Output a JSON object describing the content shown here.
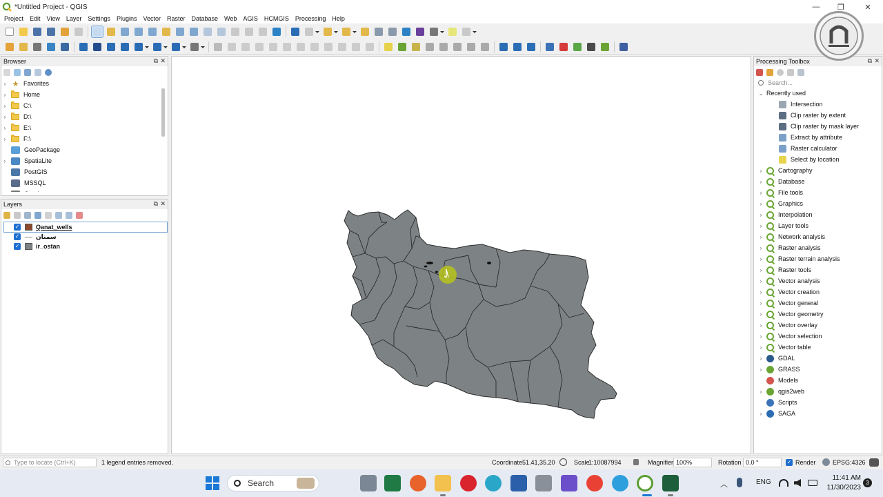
{
  "window": {
    "title": "*Untitled Project - QGIS",
    "minimize": "—",
    "restore": "❐",
    "close": "✕"
  },
  "menu": [
    "Project",
    "Edit",
    "View",
    "Layer",
    "Settings",
    "Plugins",
    "Vector",
    "Raster",
    "Database",
    "Web",
    "AGIS",
    "HCMGIS",
    "Processing",
    "Help"
  ],
  "browser": {
    "title": "Browser",
    "items": [
      {
        "label": "Favorites",
        "icon": "star-icon",
        "expandable": true
      },
      {
        "label": "Home",
        "icon": "folder-icon",
        "expandable": true
      },
      {
        "label": "C:\\",
        "icon": "folder-icon",
        "expandable": true
      },
      {
        "label": "D:\\",
        "icon": "folder-icon",
        "expandable": true
      },
      {
        "label": "E:\\",
        "icon": "folder-icon",
        "expandable": true
      },
      {
        "label": "F:\\",
        "icon": "folder-icon",
        "expandable": true
      },
      {
        "label": "GeoPackage",
        "icon": "geopackage-icon",
        "expandable": false
      },
      {
        "label": "SpatiaLite",
        "icon": "spatialite-icon",
        "expandable": true
      },
      {
        "label": "PostGIS",
        "icon": "postgis-icon",
        "expandable": false
      },
      {
        "label": "MSSQL",
        "icon": "mssql-icon",
        "expandable": false
      },
      {
        "label": "Oracle",
        "icon": "oracle-icon",
        "expandable": false
      }
    ]
  },
  "layers": {
    "title": "Layers",
    "items": [
      {
        "name": "Qanat_wells",
        "checked": true,
        "swatch": "#8b4a2b",
        "selected": true
      },
      {
        "name": "سمنان",
        "checked": true,
        "swatch": "line",
        "selected": false
      },
      {
        "name": "ir_ostan",
        "checked": true,
        "swatch": "#7d8384",
        "selected": false
      }
    ]
  },
  "toolbox": {
    "title": "Processing Toolbox",
    "search_placeholder": "Search...",
    "recent_label": "Recently used",
    "recent": [
      "Intersection",
      "Clip raster by extent",
      "Clip raster by mask layer",
      "Extract by attribute",
      "Raster calculator",
      "Select by location"
    ],
    "groups": [
      "Cartography",
      "Database",
      "File tools",
      "Graphics",
      "Interpolation",
      "Layer tools",
      "Network analysis",
      "Raster analysis",
      "Raster terrain analysis",
      "Raster tools",
      "Vector analysis",
      "Vector creation",
      "Vector general",
      "Vector geometry",
      "Vector overlay",
      "Vector selection",
      "Vector table"
    ],
    "providers": [
      "GDAL",
      "GRASS",
      "Models",
      "qgis2web",
      "Scripts",
      "SAGA"
    ]
  },
  "statusbar": {
    "locate_placeholder": "Type to locate (Ctrl+K)",
    "message": "1 legend entries removed.",
    "coordinate_label": "Coordinate",
    "coordinate_value": "51.41,35.20",
    "scale_label": "Scale",
    "scale_value": "1:10087994",
    "magnifier_label": "Magnifier",
    "magnifier_value": "100%",
    "rotation_label": "Rotation",
    "rotation_value": "0.0 °",
    "render_label": "Render",
    "crs": "EPSG:4326"
  },
  "taskbar": {
    "search_label": "Search",
    "language": "ENG",
    "time": "11:41 AM",
    "date": "11/30/2023",
    "notification_count": "3"
  },
  "colors": {
    "map_fill": "#7d8384",
    "map_stroke": "#2b2b2b",
    "highlight": "#b6c41a",
    "accent": "#1f6fd1"
  }
}
